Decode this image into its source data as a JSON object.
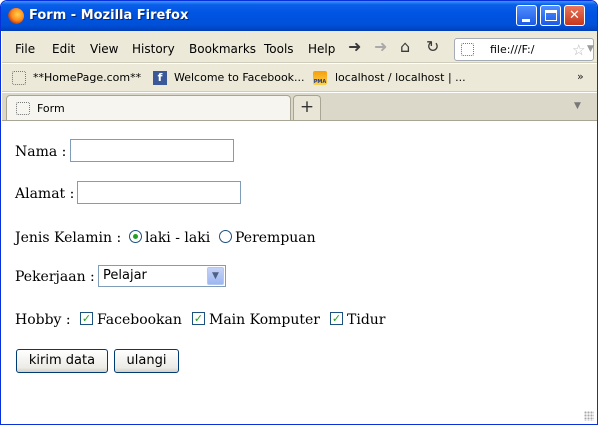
{
  "window": {
    "title": "Form - Mozilla Firefox"
  },
  "menu": [
    "File",
    "Edit",
    "View",
    "History",
    "Bookmarks",
    "Tools",
    "Help"
  ],
  "urlbar": {
    "value": "file:///F:/"
  },
  "bookmarks": [
    "**HomePage.com**",
    "Welcome to Facebook...",
    "localhost / localhost | ..."
  ],
  "bookmarks_more": "»",
  "tab": {
    "label": "Form",
    "new_tab": "+"
  },
  "form": {
    "nama_label": "Nama :",
    "nama_value": "",
    "alamat_label": "Alamat :",
    "alamat_value": "",
    "jk_label": "Jenis Kelamin :",
    "jk_options": [
      {
        "label": "laki - laki",
        "checked": true
      },
      {
        "label": "Perempuan",
        "checked": false
      }
    ],
    "pekerjaan_label": "Pekerjaan :",
    "pekerjaan_value": "Pelajar",
    "hobby_label": "Hobby :",
    "hobby_options": [
      {
        "label": "Facebookan",
        "checked": true
      },
      {
        "label": "Main Komputer",
        "checked": true
      },
      {
        "label": "Tidur",
        "checked": true
      }
    ],
    "submit_label": "kirim data",
    "reset_label": "ulangi"
  },
  "colors": {
    "titlebar": "#0054e3",
    "chrome": "#ece9d8",
    "check": "#21a121"
  }
}
